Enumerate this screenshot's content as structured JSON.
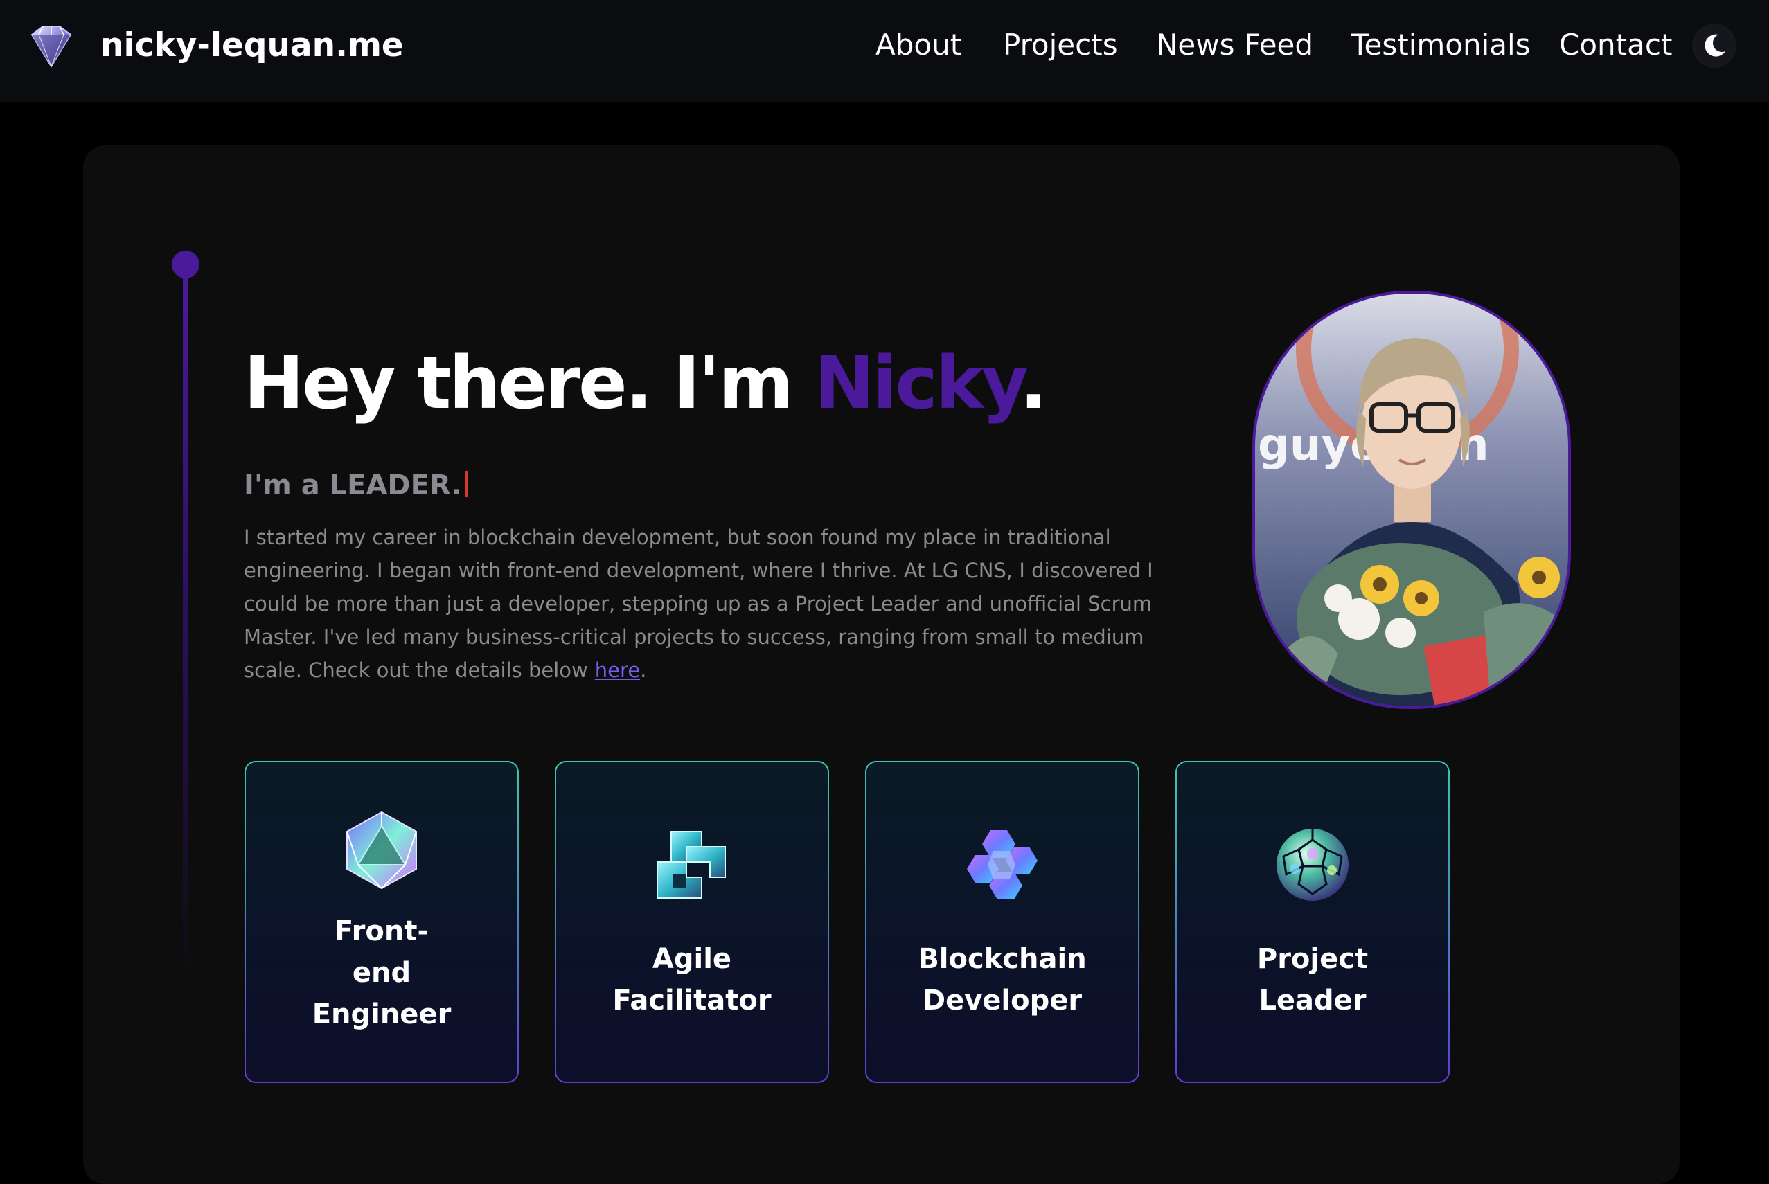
{
  "header": {
    "brand": "nicky-lequan.me",
    "nav": [
      "About",
      "Projects",
      "News Feed",
      "Testimonials",
      "Contact"
    ],
    "theme_toggle_icon": "moon-icon"
  },
  "hero": {
    "greeting_prefix": "Hey there. I'm ",
    "greeting_name": "Nicky",
    "greeting_suffix": ".",
    "role": "I'm a LEADER.",
    "bio": "I started my career in blockchain development, but soon found my place in traditional engineering. I began with front-end development, where I thrive. At LG CNS, I discovered I could be more than just a developer, stepping up as a Project Leader and unofficial Scrum Master. I've led many business-critical projects to success, ranging from small to medium scale. Check out the details below",
    "bio_link": "here",
    "bio_end": ".",
    "portrait_backdrop_text": "guye  Van",
    "accent_color": "#4a1a9a"
  },
  "features": [
    {
      "title_lines": [
        "Front-",
        "end",
        "Engineer"
      ],
      "icon": "icosahedron-icon"
    },
    {
      "title_lines": [
        "Agile",
        "Facilitator"
      ],
      "icon": "cube-knot-icon"
    },
    {
      "title_lines": [
        "Blockchain",
        "Developer"
      ],
      "icon": "hexagon-cluster-icon"
    },
    {
      "title_lines": [
        "Project",
        "Leader"
      ],
      "icon": "geodesic-sphere-icon"
    }
  ]
}
